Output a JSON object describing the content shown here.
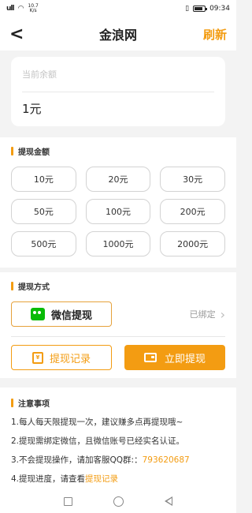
{
  "status_bar": {
    "signal": "ull",
    "wifi": "",
    "speed_value": "10.7",
    "speed_unit": "K/s",
    "battery_icon": "battery-icon",
    "time": "09:34"
  },
  "header": {
    "back_label": "<",
    "title": "金浪网",
    "refresh_label": "刷新"
  },
  "balance": {
    "label": "当前余额",
    "value": "1元"
  },
  "amounts": {
    "title": "提现金额",
    "options": [
      "10元",
      "20元",
      "30元",
      "50元",
      "100元",
      "200元",
      "500元",
      "1000元",
      "2000元"
    ]
  },
  "method": {
    "title": "提现方式",
    "wechat_label": "微信提现",
    "bound_status": "已绑定",
    "chevron": "›"
  },
  "actions": {
    "record_icon_text": "¥",
    "record_label": "提现记录",
    "withdraw_label": "立即提现"
  },
  "notes": {
    "title": "注意事项",
    "item1": "1.每人每天限提现一次，建议赚多点再提现哦~",
    "item2": "2.提现需绑定微信，且微信账号已经实名认证。",
    "item3_prefix": "3.不会提现操作，请加客服QQ群:：",
    "item3_link": "793620687",
    "item4_prefix": "4.提现进度，请查看",
    "item4_link": "提现记录"
  },
  "colors": {
    "accent": "#f39c12",
    "wechat_green": "#09bb07"
  },
  "icons": [
    "wechat-icon",
    "record-icon",
    "wallet-icon",
    "back-icon",
    "chevron-right-icon",
    "nav-back-icon",
    "nav-home-icon",
    "nav-recent-icon"
  ]
}
